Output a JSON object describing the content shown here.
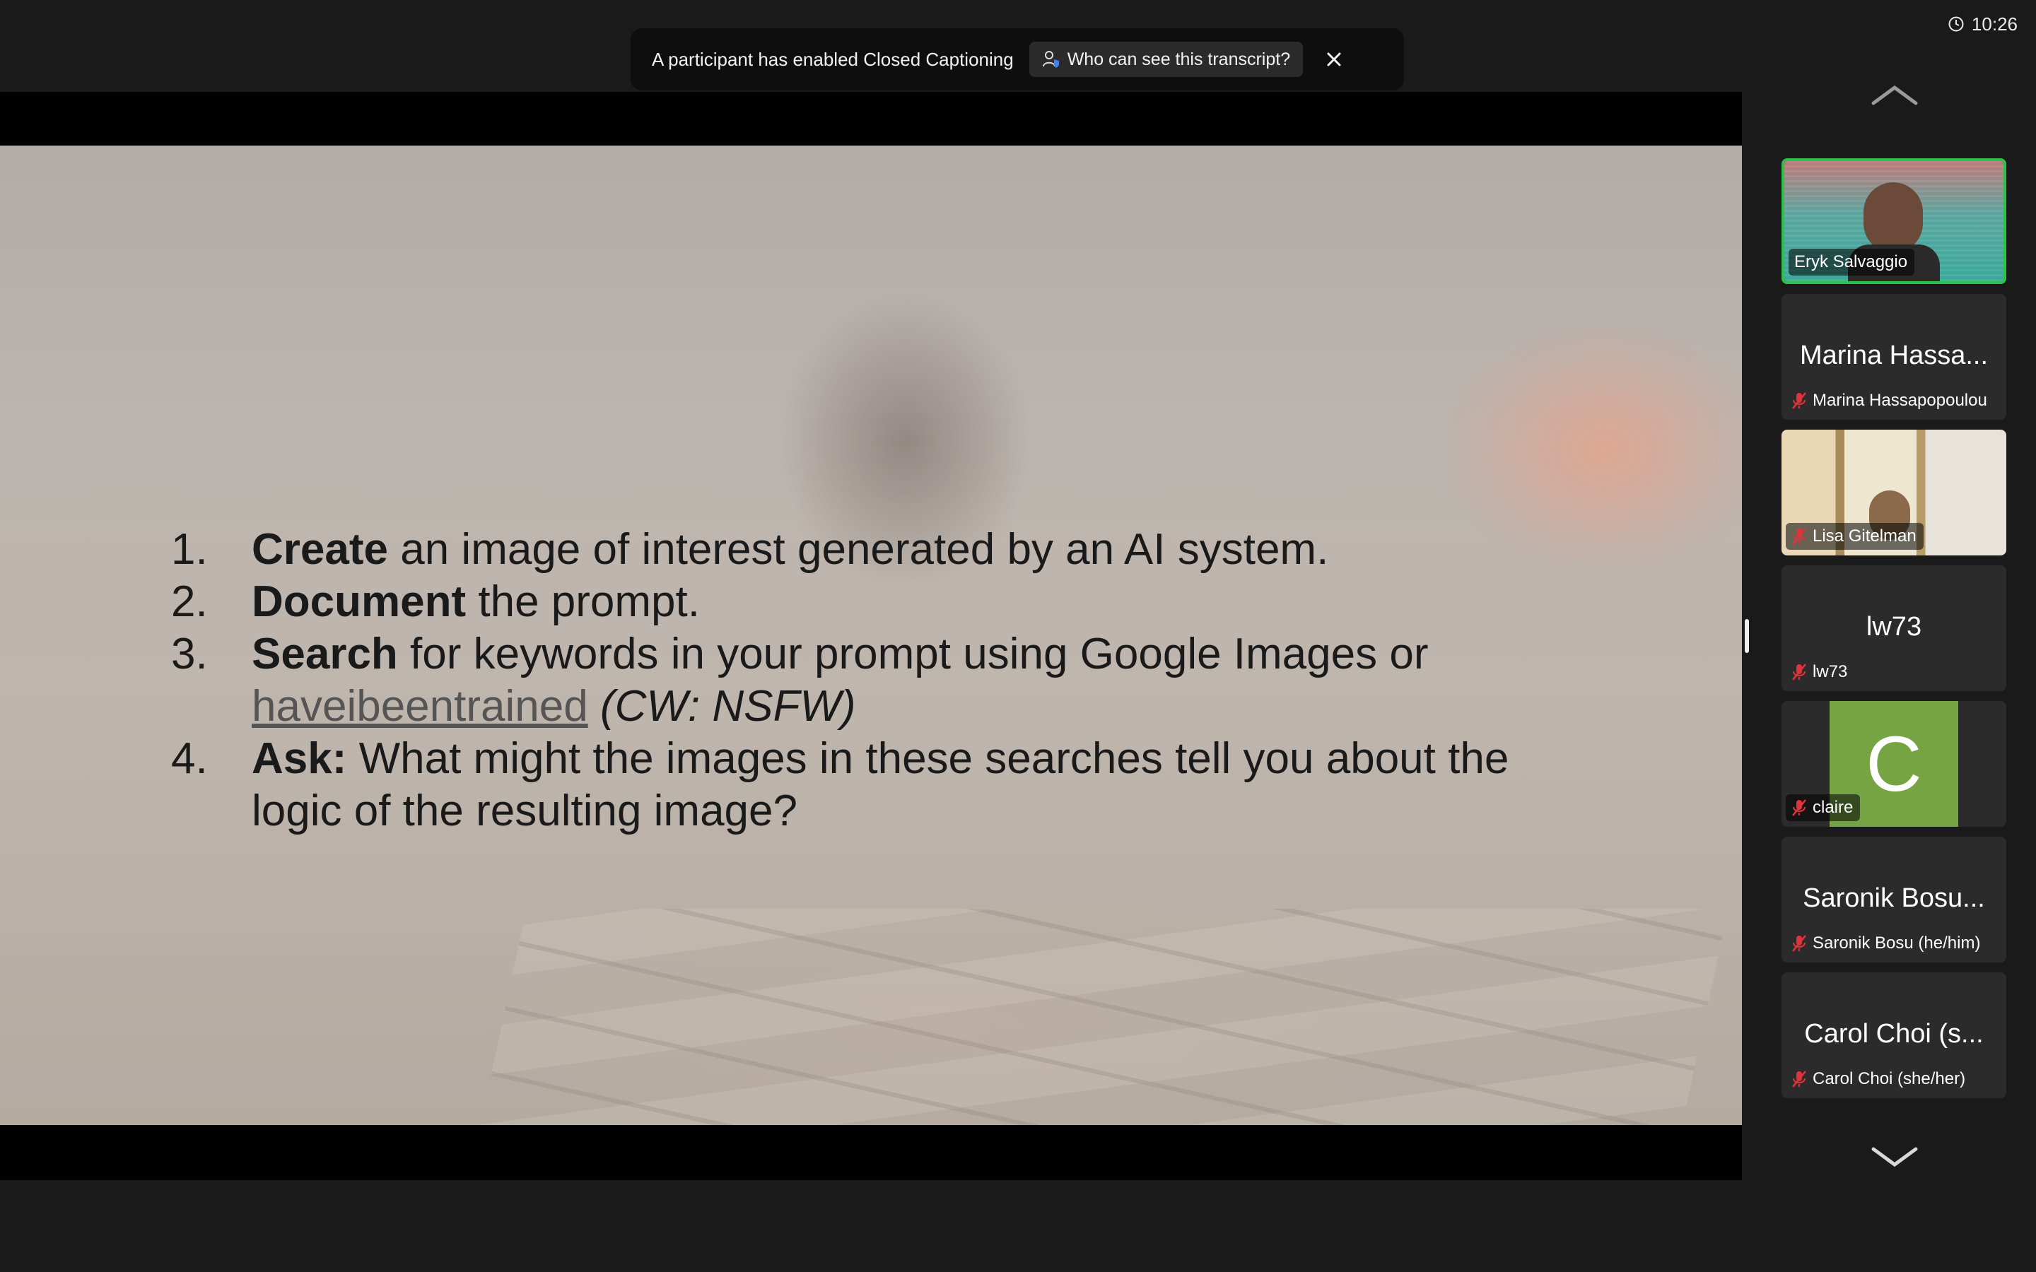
{
  "banner": {
    "message": "A participant has enabled Closed Captioning",
    "who_button": "Who can see this transcript?",
    "close_icon": "close-icon"
  },
  "clock": {
    "time": "10:26",
    "icon": "clock-icon"
  },
  "slide": {
    "items": [
      {
        "num": "1.",
        "bold": "Create",
        "text": " an image of interest generated by an AI system."
      },
      {
        "num": "2.",
        "bold": "Document",
        "text": " the prompt."
      },
      {
        "num": "3.",
        "bold": "Search",
        "text": " for keywords in your prompt using Google Images or",
        "link": "haveibeentrained",
        "italic": " (CW: NSFW)"
      },
      {
        "num": "4.",
        "bold": "Ask:",
        "text": " What might the images in these searches tell you about the logic of the resulting image?"
      }
    ]
  },
  "gallery": {
    "scroll_up_icon": "chevron-up-icon",
    "scroll_down_icon": "chevron-down-icon",
    "participants": [
      {
        "name": "Eryk Salvaggio",
        "active": true,
        "video": true
      },
      {
        "big": "Marina Hassa...",
        "name": "Marina Hassapopoulou",
        "muted": true
      },
      {
        "name": "Lisa Gitelman",
        "muted": true,
        "video": true
      },
      {
        "big": "lw73",
        "name": "lw73",
        "muted": true
      },
      {
        "avatar_letter": "C",
        "name": "claire",
        "muted": true,
        "avatar_color": "#77a443"
      },
      {
        "big": "Saronik Bosu...",
        "name": "Saronik Bosu (he/him)",
        "muted": true
      },
      {
        "big": "Carol Choi (s...",
        "name": "Carol Choi (she/her)",
        "muted": true
      }
    ]
  },
  "colors": {
    "active_border": "#2dc24a",
    "muted_icon": "#e0343a"
  }
}
